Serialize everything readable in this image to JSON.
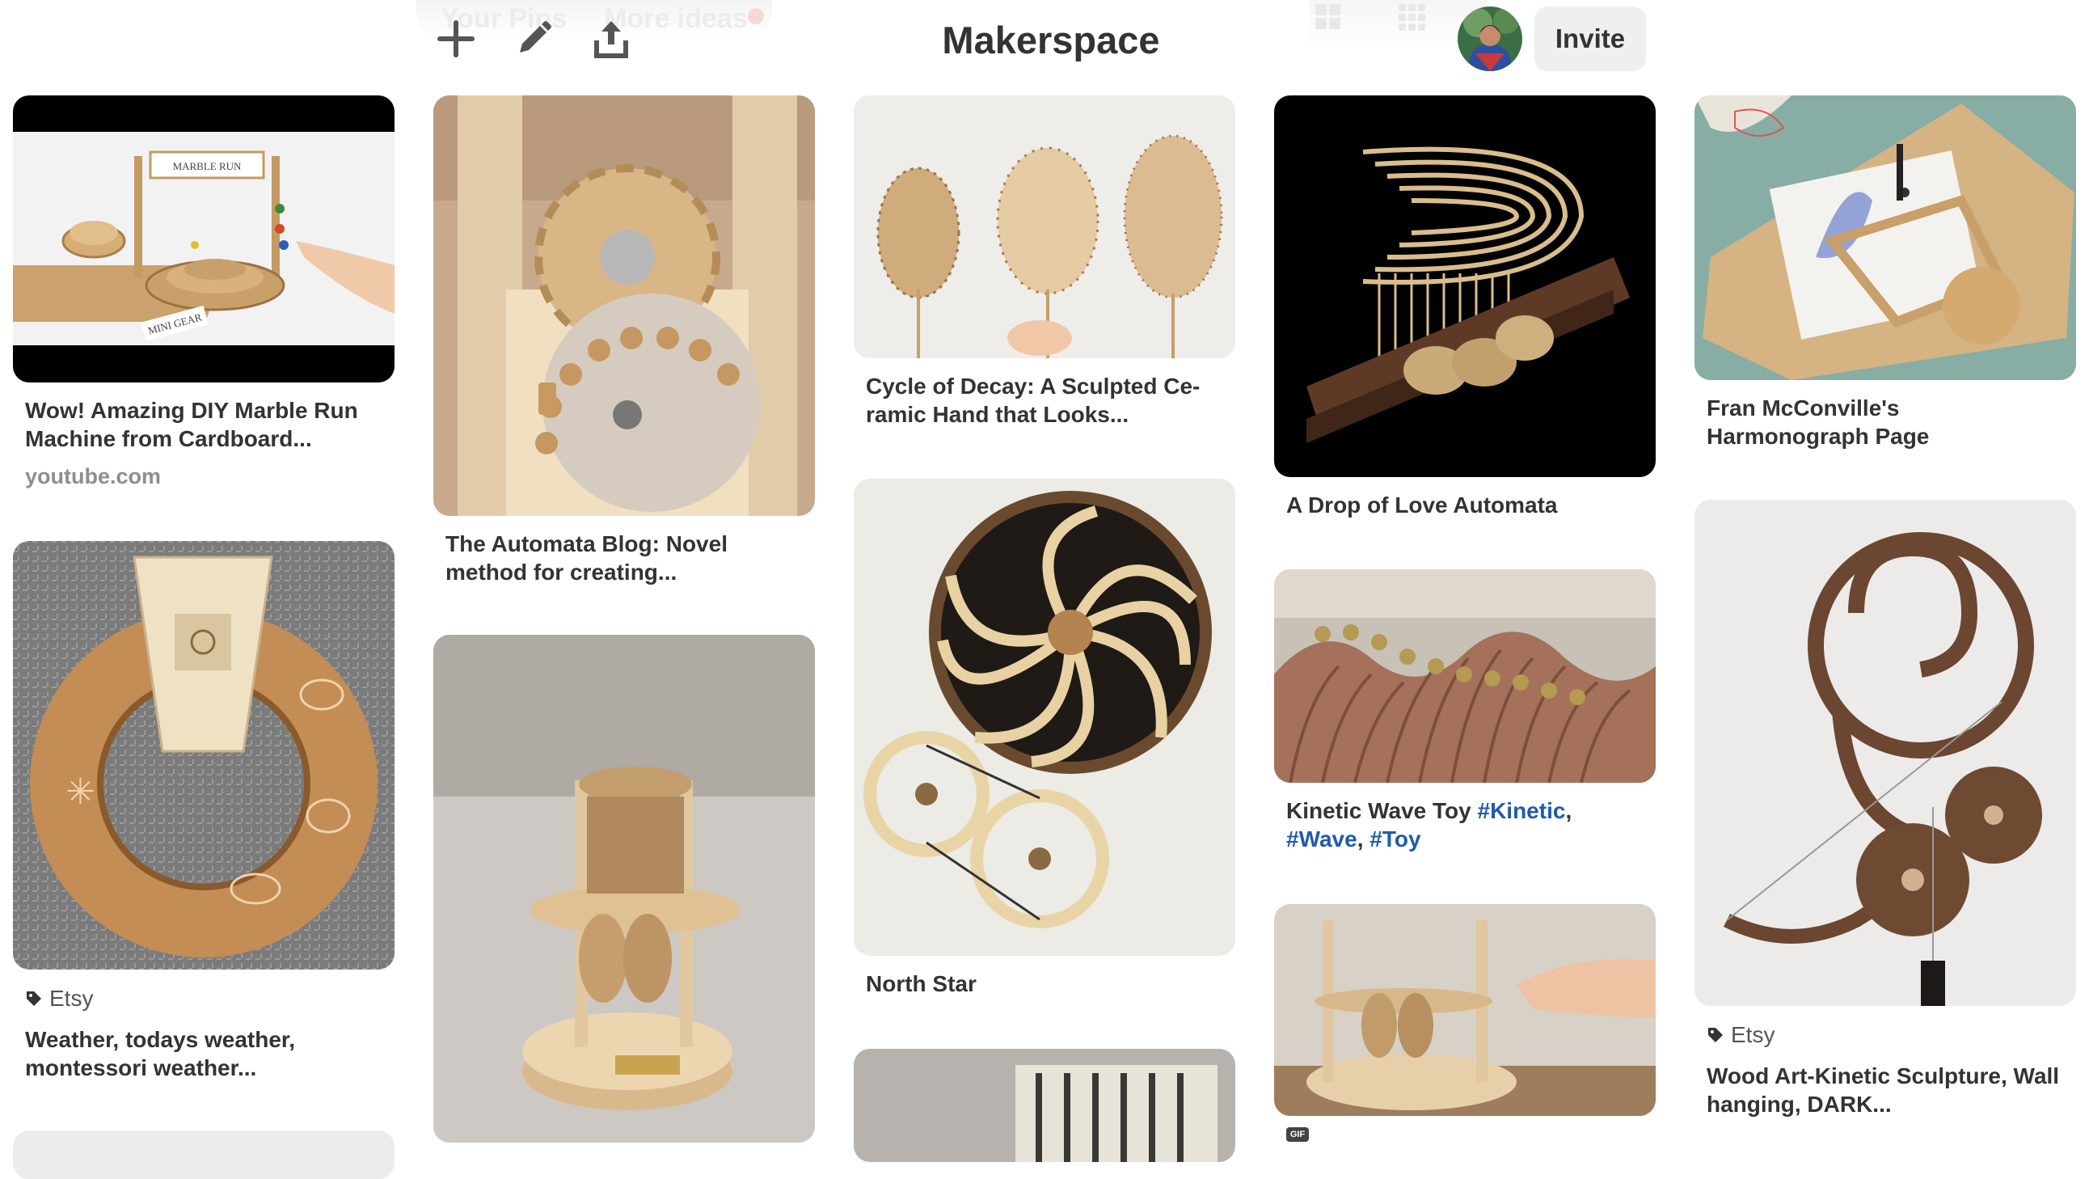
{
  "header": {
    "title": "Makerspace",
    "invite_label": "Invite",
    "ghost_tabs": [
      "Your Pins",
      "More ideas"
    ],
    "tools": [
      {
        "icon": "plus-icon",
        "action": "add"
      },
      {
        "icon": "pencil-icon",
        "action": "edit"
      },
      {
        "icon": "share-icon",
        "action": "share"
      }
    ]
  },
  "pins": [
    {
      "title": "Wow! Amazing DIY Marble Run Machine from Cardboard...",
      "domain": "youtube.com",
      "image_text": [
        "MARBLE RUN",
        "MINI GEAR"
      ]
    },
    {
      "title": "The Automata Blog: Novel method for creating..."
    },
    {
      "title": "Cycle of Decay: A Sculpted Ce-ramic Hand that Looks..."
    },
    {
      "title": "A Drop of Love Automata"
    },
    {
      "title": "Fran McConville's Harmonograph Page"
    },
    {
      "title": "Weather, todays weather, montessori weather...",
      "source": "Etsy"
    },
    {
      "title": ""
    },
    {
      "title": "North Star"
    },
    {
      "title_parts": [
        "Kinetic Wave Toy ",
        "#Kinetic",
        ", ",
        "#Wave",
        ", ",
        "#Toy"
      ]
    },
    {
      "title": "Wood Art-Kinetic Sculpture, Wall hanging, DARK...",
      "source": "Etsy"
    },
    {
      "badge": "GIF"
    }
  ],
  "colors": {
    "text": "#333333",
    "muted": "#8e8e8e",
    "hashtag": "#1f5ba8",
    "invite_bg": "#efefef"
  }
}
